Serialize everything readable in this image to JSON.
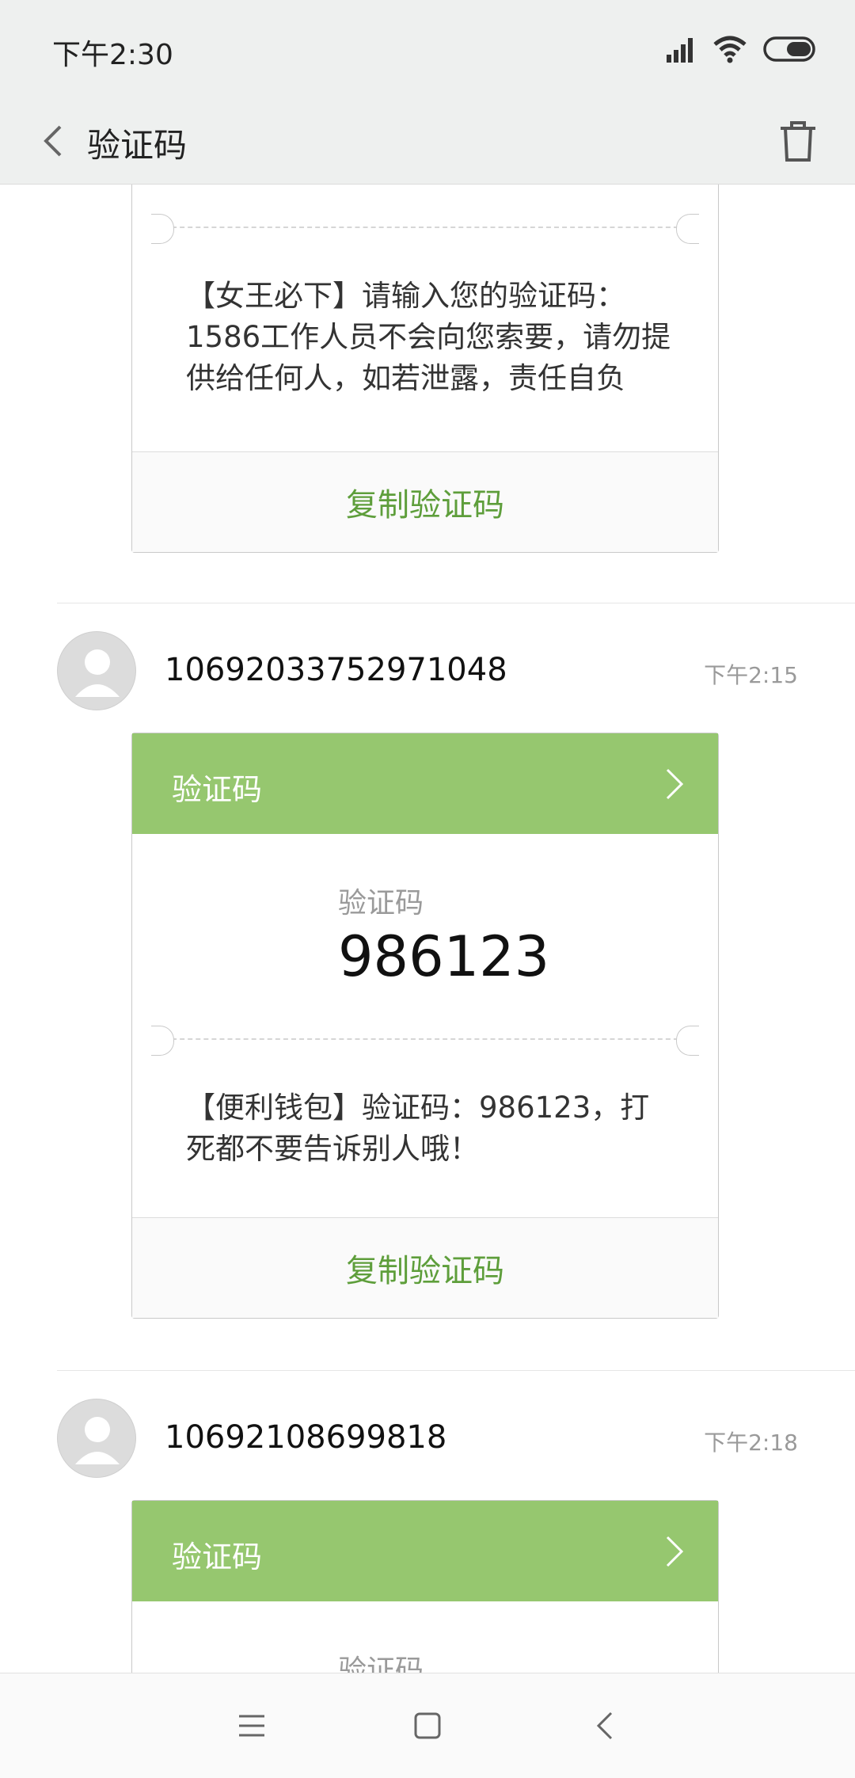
{
  "status_bar": {
    "time": "下午2:30"
  },
  "header": {
    "title": "验证码"
  },
  "messages": [
    {
      "body": "【女王必下】请输入您的验证码：1586工作人员不会向您索要，请勿提供给任何人，如若泄露，责任自负",
      "copy_label": "复制验证码"
    },
    {
      "sender": "10692033752971048",
      "time": "下午2:15",
      "card_title": "验证码",
      "code_label": "验证码",
      "code": "986123",
      "body": "【便利钱包】验证码：986123，打死都不要告诉别人哦！",
      "copy_label": "复制验证码"
    },
    {
      "sender": "10692108699818",
      "time": "下午2:18",
      "card_title": "验证码",
      "code_label": "验证码"
    }
  ],
  "colors": {
    "accent_green": "#96c76f",
    "copy_green": "#5e9e3b",
    "bar_bg": "#eef0ef"
  },
  "icons": [
    "signal-icon",
    "wifi-icon",
    "battery-icon",
    "back-icon",
    "trash-icon",
    "chevron-right-icon",
    "menu-icon",
    "home-icon",
    "nav-back-icon"
  ]
}
